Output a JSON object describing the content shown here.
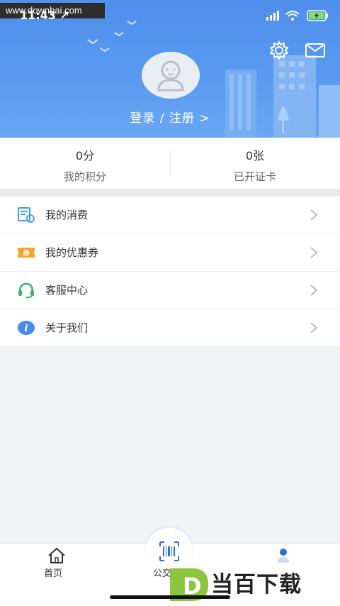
{
  "watermark": "www.downbai.com",
  "status": {
    "time": "11:43 ↗"
  },
  "header": {
    "login": "登录 / 注册 >"
  },
  "stats": [
    {
      "value": "0分",
      "label": "我的积分"
    },
    {
      "value": "0张",
      "label": "已开证卡"
    }
  ],
  "menu": [
    {
      "label": "我的消费",
      "icon": "receipt-icon"
    },
    {
      "label": "我的优惠券",
      "icon": "coupon-icon"
    },
    {
      "label": "客服中心",
      "icon": "headset-icon"
    },
    {
      "label": "关于我们",
      "icon": "info-icon"
    }
  ],
  "tabbar": {
    "home": "首页",
    "center": "公交"
  },
  "brand": {
    "text": "当百下载",
    "letter": "D"
  },
  "colors": {
    "header": "#5596ee",
    "background": "#eef5f6",
    "accent": "#4a8bee"
  }
}
